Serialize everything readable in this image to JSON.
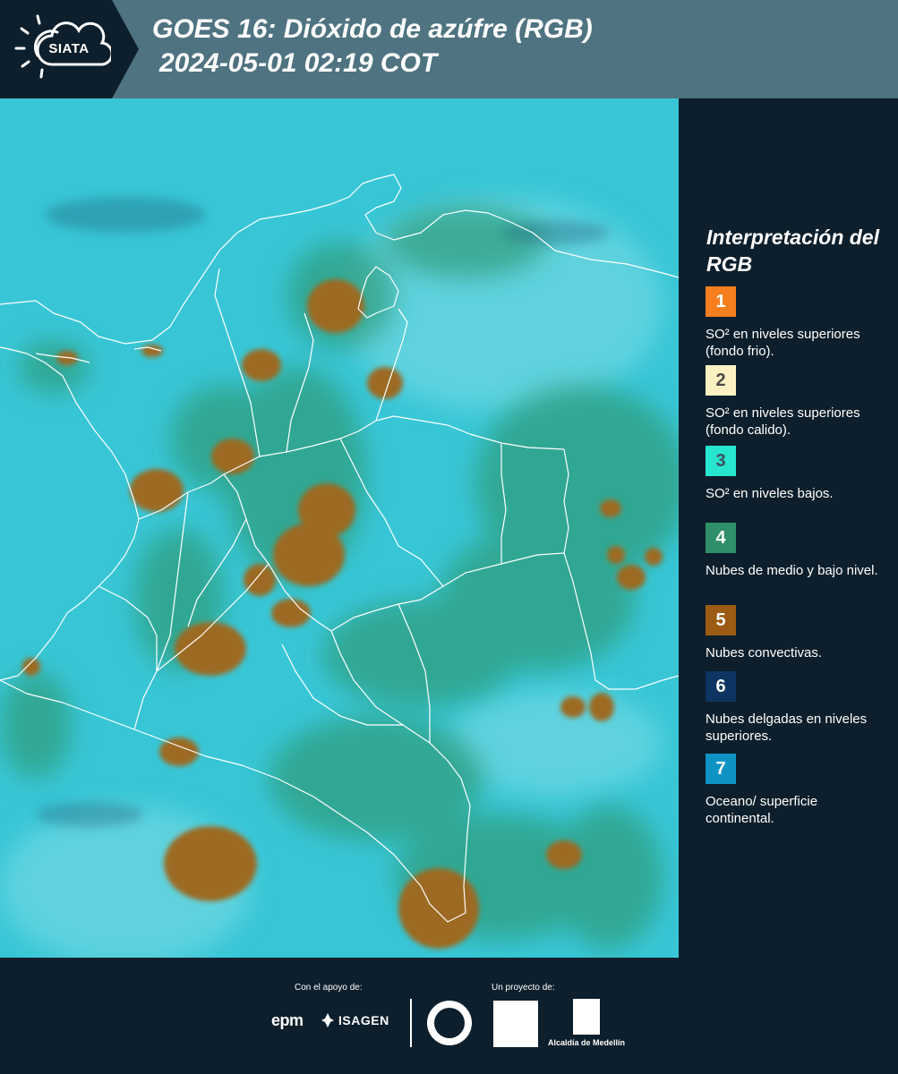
{
  "header": {
    "logo_text": "SIATA",
    "title_line1": "GOES 16: Dióxido de azúfre (RGB)",
    "title_line2": "2024-05-01 02:19 COT"
  },
  "legend": {
    "title": "Interpretación del RGB",
    "items": [
      {
        "number": "1",
        "color": "#f57e1e",
        "text_color": "#ffffff",
        "label": "SO² en niveles superiores (fondo frio)."
      },
      {
        "number": "2",
        "color": "#fbf1c2",
        "text_color": "#4a4a4a",
        "label": "SO² en niveles superiores (fondo calido)."
      },
      {
        "number": "3",
        "color": "#27e6cf",
        "text_color": "#3a5060",
        "label": "SO² en niveles bajos."
      },
      {
        "number": "4",
        "color": "#2f8f68",
        "text_color": "#ffffff",
        "label": "Nubes de medio y bajo nivel."
      },
      {
        "number": "5",
        "color": "#9c5b12",
        "text_color": "#ffffff",
        "label": "Nubes convectivas."
      },
      {
        "number": "6",
        "color": "#0e3462",
        "text_color": "#ffffff",
        "label": "Nubes delgadas en niveles superiores."
      },
      {
        "number": "7",
        "color": "#0f93c4",
        "text_color": "#ffffff",
        "label": "Oceano/ superficie continental."
      }
    ]
  },
  "footer": {
    "support_label": "Con el apoyo de:",
    "project_label": "Un proyecto de:",
    "sponsors": [
      "epm",
      "ISAGEN"
    ],
    "project_org": "Alcaldía de Medellín"
  },
  "colors": {
    "header_bg": "#4f7380",
    "panel_bg": "#0d1f2c",
    "map_background": "#38c6d6",
    "convective_cloud": "#9c6a22",
    "mid_cloud": "#2f8f68"
  }
}
